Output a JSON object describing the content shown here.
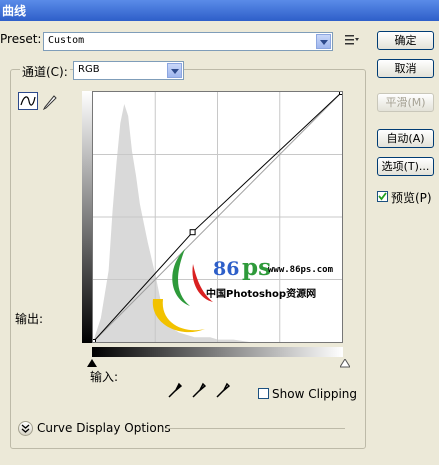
{
  "window": {
    "title": "曲线"
  },
  "preset": {
    "label": "Preset:",
    "value": "Custom"
  },
  "channel": {
    "label": "通道(C):",
    "value": "RGB"
  },
  "buttons": {
    "ok": "确定",
    "cancel": "取消",
    "smooth": "平滑(M)",
    "auto": "自动(A)",
    "options": "选项(T)..."
  },
  "preview": {
    "label": "预览(P)",
    "checked": true
  },
  "axes": {
    "output_label": "输出:",
    "input_label": "输入:"
  },
  "show_clipping": {
    "label": "Show Clipping",
    "checked": false
  },
  "curve_display_options": {
    "label": "Curve Display Options"
  },
  "watermark": {
    "number": "86",
    "letters": "ps",
    "url": "www.86ps.com",
    "site_name": "中国Photoshop资源网"
  },
  "chart_data": {
    "type": "line",
    "xlim": [
      0,
      255
    ],
    "ylim": [
      0,
      255
    ],
    "grid": true,
    "grid_divisions": 4,
    "baseline": {
      "x": [
        0,
        255
      ],
      "y": [
        0,
        255
      ]
    },
    "curve_points": {
      "x": [
        0,
        102,
        255
      ],
      "y": [
        0,
        112,
        255
      ]
    },
    "histogram": {
      "x": [
        0,
        8,
        16,
        20,
        24,
        28,
        32,
        36,
        40,
        44,
        48,
        52,
        56,
        60,
        64,
        68,
        72,
        80,
        88,
        96,
        104,
        112,
        120,
        128,
        136,
        144,
        160,
        176,
        192,
        208,
        224,
        240,
        255
      ],
      "counts": [
        0,
        10,
        30,
        55,
        75,
        92,
        100,
        95,
        80,
        70,
        58,
        50,
        42,
        35,
        28,
        20,
        12,
        6,
        4,
        3,
        2,
        2,
        2,
        1,
        1,
        1,
        0,
        0,
        0,
        0,
        0,
        0,
        0
      ]
    }
  }
}
